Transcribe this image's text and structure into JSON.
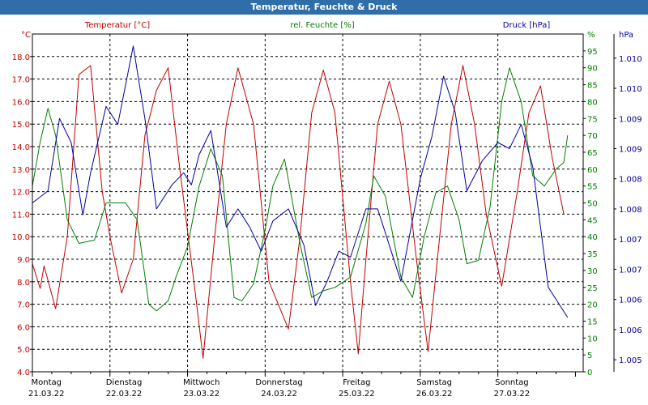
{
  "window": {
    "title": "Temperatur, Feuchte & Druck"
  },
  "chart_data": {
    "type": "line",
    "title": "Temperatur, Feuchte & Druck",
    "x_days": [
      "Montag",
      "Dienstag",
      "Mittwoch",
      "Donnerstag",
      "Freitag",
      "Samstag",
      "Sonntag"
    ],
    "x_dates": [
      "21.03.22",
      "22.03.22",
      "23.03.22",
      "24.03.22",
      "25.03.22",
      "26.03.22",
      "27.03.22"
    ],
    "x_day_range": [
      0,
      7.1
    ],
    "grid": true,
    "axes": {
      "temperature": {
        "unit": "°C",
        "ticks": [
          "4.0",
          "5.0",
          "6.0",
          "7.0",
          "8.0",
          "9.0",
          "10.0",
          "11.0",
          "12.0",
          "13.0",
          "14.0",
          "15.0",
          "16.0",
          "17.0",
          "18.0"
        ],
        "range": [
          4,
          19
        ],
        "color": "#c00000"
      },
      "humidity": {
        "unit": "%",
        "ticks": [
          "0",
          "5",
          "10",
          "15",
          "20",
          "25",
          "30",
          "35",
          "40",
          "45",
          "50",
          "55",
          "60",
          "65",
          "70",
          "75",
          "80",
          "85",
          "90",
          "95"
        ],
        "range": [
          0,
          100
        ],
        "color": "#008000"
      },
      "pressure": {
        "unit": "hPa",
        "ticks": [
          "1.005",
          "1.006",
          "1.006",
          "1.007",
          "1.007",
          "1.008",
          "1.008",
          "1.009",
          "1.009",
          "1.010",
          "1.010"
        ],
        "tick_positions": [
          1.005,
          1.0055,
          1.006,
          1.0065,
          1.007,
          1.0075,
          1.008,
          1.0085,
          1.009,
          1.0095,
          1.01
        ],
        "range": [
          1.0048,
          1.0104
        ],
        "color": "#0000a0"
      }
    },
    "series": [
      {
        "name": "Temperatur [°C]",
        "axis": "temperature",
        "color": "#c00000",
        "points": [
          [
            0,
            8.8
          ],
          [
            0.1,
            7.7
          ],
          [
            0.15,
            8.7
          ],
          [
            0.3,
            6.8
          ],
          [
            0.45,
            10
          ],
          [
            0.6,
            17.2
          ],
          [
            0.75,
            17.6
          ],
          [
            0.9,
            12
          ],
          [
            1.0,
            10
          ],
          [
            1.15,
            7.5
          ],
          [
            1.3,
            9
          ],
          [
            1.45,
            14.5
          ],
          [
            1.6,
            16.5
          ],
          [
            1.75,
            17.5
          ],
          [
            1.9,
            13
          ],
          [
            2.1,
            7.5
          ],
          [
            2.2,
            4.6
          ],
          [
            2.35,
            10
          ],
          [
            2.5,
            15
          ],
          [
            2.65,
            17.5
          ],
          [
            2.85,
            15
          ],
          [
            3.05,
            8
          ],
          [
            3.3,
            5.9
          ],
          [
            3.45,
            10
          ],
          [
            3.6,
            15.5
          ],
          [
            3.75,
            17.4
          ],
          [
            3.9,
            15.5
          ],
          [
            4.1,
            8
          ],
          [
            4.2,
            4.8
          ],
          [
            4.3,
            9
          ],
          [
            4.45,
            15
          ],
          [
            4.6,
            16.9
          ],
          [
            4.75,
            15
          ],
          [
            4.95,
            9
          ],
          [
            5.1,
            4.9
          ],
          [
            5.25,
            10
          ],
          [
            5.4,
            15
          ],
          [
            5.55,
            17.6
          ],
          [
            5.7,
            15
          ],
          [
            5.85,
            11
          ],
          [
            6.05,
            7.8
          ],
          [
            6.25,
            12
          ],
          [
            6.4,
            15.5
          ],
          [
            6.55,
            16.7
          ],
          [
            6.7,
            13.5
          ],
          [
            6.85,
            11
          ]
        ]
      },
      {
        "name": "rel. Feuchte [%]",
        "axis": "humidity",
        "color": "#008000",
        "points": [
          [
            0,
            55
          ],
          [
            0.1,
            68
          ],
          [
            0.2,
            78
          ],
          [
            0.3,
            70
          ],
          [
            0.45,
            45
          ],
          [
            0.6,
            38
          ],
          [
            0.8,
            39
          ],
          [
            0.95,
            50
          ],
          [
            1.2,
            50
          ],
          [
            1.35,
            45
          ],
          [
            1.5,
            20
          ],
          [
            1.6,
            18
          ],
          [
            1.75,
            21
          ],
          [
            1.85,
            28
          ],
          [
            2.0,
            37
          ],
          [
            2.15,
            55
          ],
          [
            2.3,
            66
          ],
          [
            2.45,
            58
          ],
          [
            2.6,
            22
          ],
          [
            2.7,
            21
          ],
          [
            2.85,
            26
          ],
          [
            3.0,
            42
          ],
          [
            3.1,
            55
          ],
          [
            3.25,
            63
          ],
          [
            3.45,
            38
          ],
          [
            3.6,
            22
          ],
          [
            3.75,
            24
          ],
          [
            3.9,
            25
          ],
          [
            4.1,
            28
          ],
          [
            4.3,
            44
          ],
          [
            4.4,
            58
          ],
          [
            4.55,
            52
          ],
          [
            4.75,
            28
          ],
          [
            4.9,
            22
          ],
          [
            5.05,
            40
          ],
          [
            5.2,
            53
          ],
          [
            5.35,
            55
          ],
          [
            5.5,
            45
          ],
          [
            5.6,
            32
          ],
          [
            5.75,
            33
          ],
          [
            5.9,
            49
          ],
          [
            6.05,
            80
          ],
          [
            6.15,
            90
          ],
          [
            6.3,
            80
          ],
          [
            6.45,
            58
          ],
          [
            6.6,
            55
          ],
          [
            6.75,
            60
          ],
          [
            6.85,
            62
          ],
          [
            6.9,
            70
          ]
        ]
      },
      {
        "name": "Druck [hPa]",
        "axis": "pressure",
        "color": "#0000a0",
        "points": [
          [
            0,
            1.0076
          ],
          [
            0.1,
            1.0077
          ],
          [
            0.2,
            1.0078
          ],
          [
            0.35,
            1.009
          ],
          [
            0.5,
            1.0086
          ],
          [
            0.65,
            1.0074
          ],
          [
            0.75,
            1.0081
          ],
          [
            0.95,
            1.0092
          ],
          [
            1.1,
            1.0089
          ],
          [
            1.3,
            1.0102
          ],
          [
            1.45,
            1.009
          ],
          [
            1.6,
            1.0075
          ],
          [
            1.8,
            1.0079
          ],
          [
            1.95,
            1.0081
          ],
          [
            2.05,
            1.0079
          ],
          [
            2.15,
            1.0084
          ],
          [
            2.3,
            1.0088
          ],
          [
            2.5,
            1.0072
          ],
          [
            2.65,
            1.0075
          ],
          [
            2.8,
            1.0072
          ],
          [
            2.95,
            1.0068
          ],
          [
            3.1,
            1.0073
          ],
          [
            3.3,
            1.0075
          ],
          [
            3.5,
            1.0069
          ],
          [
            3.65,
            1.0059
          ],
          [
            3.8,
            1.0063
          ],
          [
            3.95,
            1.0068
          ],
          [
            4.1,
            1.0067
          ],
          [
            4.3,
            1.0075
          ],
          [
            4.45,
            1.0075
          ],
          [
            4.55,
            1.0071
          ],
          [
            4.75,
            1.0063
          ],
          [
            5.0,
            1.008
          ],
          [
            5.15,
            1.0087
          ],
          [
            5.3,
            1.0097
          ],
          [
            5.45,
            1.0091
          ],
          [
            5.6,
            1.0078
          ],
          [
            5.8,
            1.0083
          ],
          [
            6.0,
            1.0086
          ],
          [
            6.15,
            1.0085
          ],
          [
            6.3,
            1.0089
          ],
          [
            6.45,
            1.0082
          ],
          [
            6.65,
            1.0062
          ],
          [
            6.8,
            1.0059
          ],
          [
            6.9,
            1.0057
          ]
        ]
      }
    ]
  }
}
